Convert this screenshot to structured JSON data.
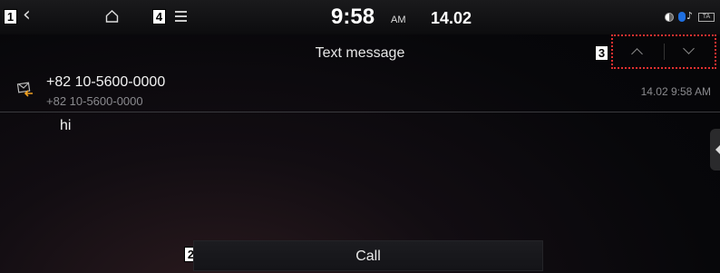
{
  "statusbar": {
    "clock": "9:58",
    "ampm": "AM",
    "date": "14.02",
    "ta_badge": "TA",
    "icons": [
      "back-icon",
      "home-icon",
      "menu-icon",
      "dnd-moon-icon",
      "bluetooth-icon",
      "music-note-icon",
      "ta-badge"
    ]
  },
  "callouts": {
    "c1": "1",
    "c2": "2",
    "c3": "3",
    "c4": "4"
  },
  "header": {
    "title": "Text message",
    "nav": {
      "up_icon": "chevron-up-icon",
      "down_icon": "chevron-down-icon"
    }
  },
  "message": {
    "sender_name": "+82 10-5600-0000",
    "sender_number": "+82 10-5600-0000",
    "timestamp": "14.02 9:58 AM",
    "body": "hi",
    "icon": "received-message-icon"
  },
  "actions": {
    "call_label": "Call"
  },
  "colors": {
    "accent_icon": "#f0a020",
    "callout_border": "#e03030",
    "bluetooth": "#1f6fe0"
  }
}
